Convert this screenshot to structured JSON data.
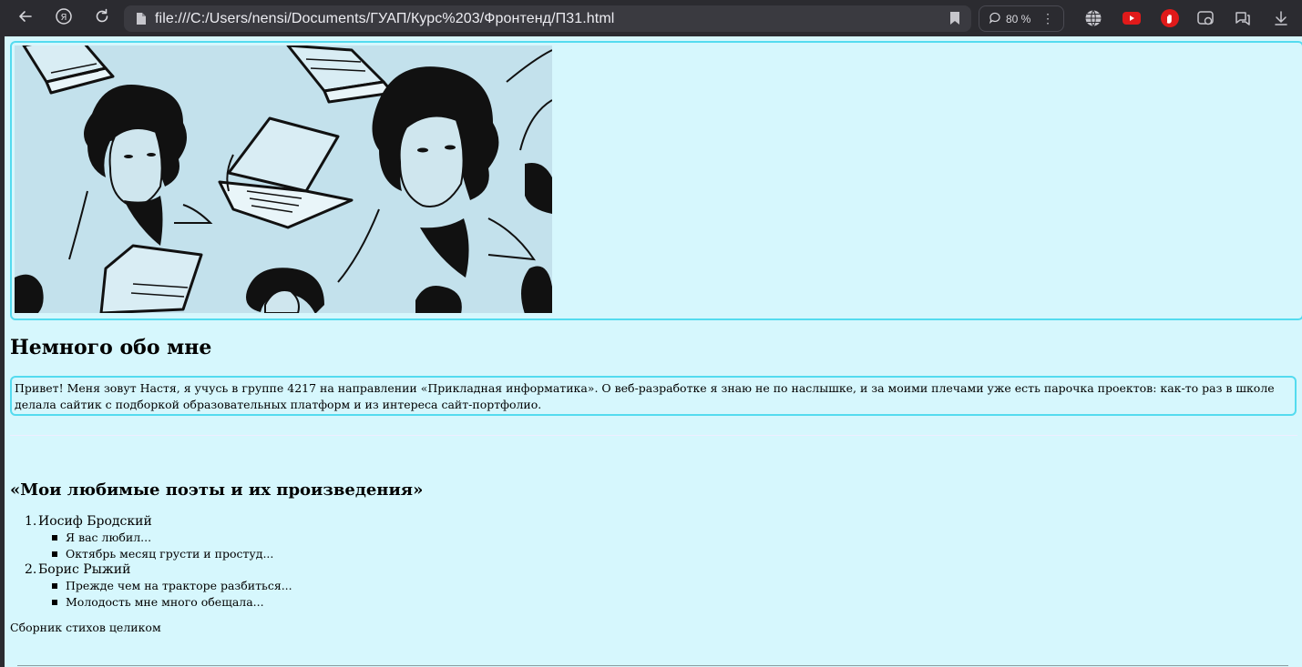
{
  "browser": {
    "url": "file:///C:/Users/nensi/Documents/ГУАП/Курс%203/Фронтенд/П31.html",
    "zoom": "80 %",
    "menu_dots": "⋮",
    "toolbar_icons": [
      "back-icon",
      "yandex-icon",
      "reload-icon",
      "file-icon",
      "bookmark-icon",
      "comment-icon",
      "globe-icon",
      "youtube-icon",
      "hand-icon",
      "screenshot-icon",
      "chat-icon",
      "download-icon"
    ]
  },
  "page": {
    "background": "#d6f7fd",
    "accent_border": "#54dbef",
    "banner_image": "pushkin-laptops-pattern",
    "about_heading": "Немного обо мне",
    "about_text": "Привет! Меня зовут Настя, я учусь в группе 4217 на направлении «Прикладная информатика». О веб-разработке я знаю не по наслышке, и за моими плечами уже есть парочка проектов: как-то раз в школе делала сайтик с подборкой образовательных платформ и из интереса сайт-портфолио.",
    "poets_heading": "«Мои любимые поэты и их произведения»",
    "poets": [
      {
        "num": "1.",
        "name": "Иосиф Бродский",
        "poems": [
          "Я вас любил...",
          "Октябрь месяц грусти и простуд..."
        ]
      },
      {
        "num": "2.",
        "name": "Борис Рыжий",
        "poems": [
          "Прежде чем на тракторе разбиться...",
          "Молодость мне много обещала..."
        ]
      }
    ],
    "collection_link": "Сборник стихов целиком"
  }
}
